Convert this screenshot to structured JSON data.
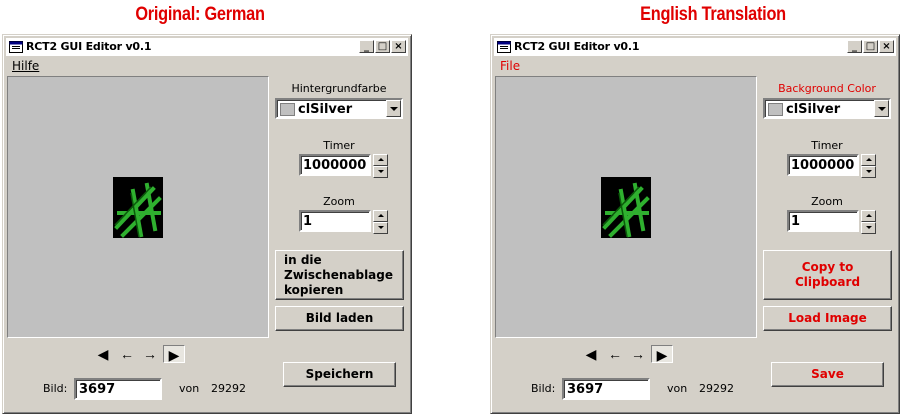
{
  "captions": {
    "left": "Original: German",
    "right": "English Translation"
  },
  "windows": [
    {
      "id": "german",
      "title": "RCT2 GUI Editor v0.1",
      "menu": "Hilfe",
      "bg_label": "Hintergrundfarbe",
      "color_value": "clSilver",
      "timer_label": "Timer",
      "timer_value": "1000000",
      "zoom_label": "Zoom",
      "zoom_value": "1",
      "copy_button": "in die\nZwischenablage\nkopieren",
      "load_button": "Bild laden",
      "save_button": "Speichern",
      "image_label": "Bild:",
      "image_value": "3697",
      "of_label": "von",
      "total": "29292"
    },
    {
      "id": "english",
      "title": "RCT2 GUI Editor v0.1",
      "menu": "File",
      "bg_label": "Background Color",
      "color_value": "clSilver",
      "timer_label": "Timer",
      "timer_value": "1000000",
      "zoom_label": "Zoom",
      "zoom_value": "1",
      "copy_button": "Copy to\nClipboard",
      "load_button": "Load Image",
      "save_button": "Save",
      "image_label": "Bild:",
      "image_value": "3697",
      "of_label": "von",
      "total": "29292"
    }
  ],
  "colors": {
    "caption": "#e00000",
    "window_face": "#d4d0c8",
    "canvas": "#c0c0c0",
    "translation_text": "#e00000"
  },
  "icons": [
    "app-icon",
    "minimize-icon",
    "maximize-icon",
    "close-icon",
    "first-arrow-icon",
    "prev-arrow-icon",
    "next-arrow-icon",
    "last-arrow-icon",
    "dropdown-arrow-icon"
  ]
}
